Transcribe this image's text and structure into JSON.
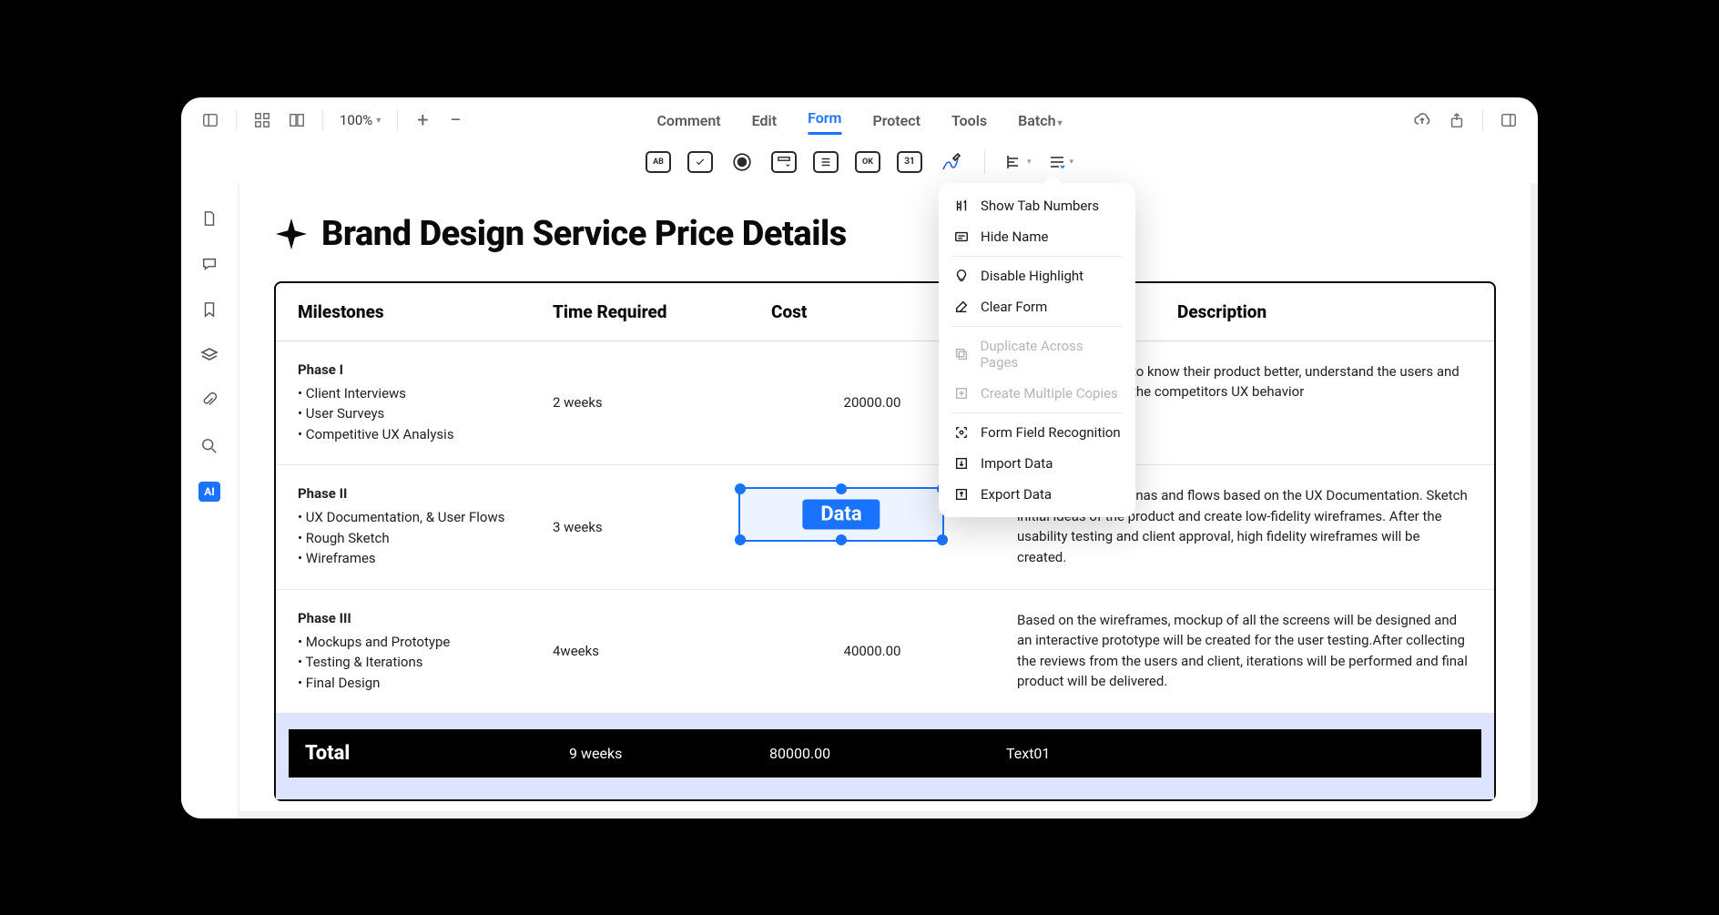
{
  "toolbar": {
    "zoom": "100%",
    "menus": [
      "Comment",
      "Edit",
      "Form",
      "Protect",
      "Tools",
      "Batch"
    ],
    "active_menu": "Form"
  },
  "form_tools": {
    "buttons": [
      "AB",
      "check",
      "radio",
      "dropdown",
      "list",
      "OK",
      "31",
      "sign"
    ],
    "align": "left",
    "more": "options"
  },
  "dropdown": {
    "items": [
      {
        "label": "Show Tab Numbers",
        "enabled": true,
        "icon": "numbers"
      },
      {
        "label": "Hide Name",
        "enabled": true,
        "icon": "name"
      },
      {
        "label": "Disable Highlight",
        "enabled": true,
        "icon": "highlight"
      },
      {
        "label": "Clear Form",
        "enabled": true,
        "icon": "erase"
      },
      {
        "label": "Duplicate Across Pages",
        "enabled": false,
        "icon": "duplicate"
      },
      {
        "label": "Create Multiple Copies",
        "enabled": false,
        "icon": "copies"
      },
      {
        "label": "Form Field Recognition",
        "enabled": true,
        "icon": "recognize"
      },
      {
        "label": "Import Data",
        "enabled": true,
        "icon": "import"
      },
      {
        "label": "Export Data",
        "enabled": true,
        "icon": "export"
      }
    ]
  },
  "document": {
    "title": "Brand Design Service Price Details",
    "columns": [
      "Milestones",
      "Time Required",
      "Cost",
      "Description"
    ],
    "rows": [
      {
        "phase": "Phase I",
        "bullets": [
          "Client Interviews",
          "User Surveys",
          "Competitive UX Analysis"
        ],
        "time": "2 weeks",
        "cost": "20000.00",
        "desc": "to know their product better, understand the users and the competitors UX behavior"
      },
      {
        "phase": "Phase II",
        "bullets": [
          "UX Documentation, & User Flows",
          "Rough Sketch",
          "Wireframes"
        ],
        "time": "3 weeks",
        "cost": "",
        "desc": "Creating user personas and flows based on the UX Documentation. Sketch initial ideas of the product and create low-fidelity wireframes. After the usability testing and client approval, high fidelity wireframes will be created."
      },
      {
        "phase": "Phase III",
        "bullets": [
          "Mockups and Prototype",
          "Testing & Iterations",
          "Final Design"
        ],
        "time": "4weeks",
        "cost": "40000.00",
        "desc": "Based on the wireframes, mockup of all the screens will be designed and an interactive prototype will be created for the user testing.After collecting the reviews from the users and client, iterations will be performed and final product will be delivered."
      }
    ],
    "total": {
      "label": "Total",
      "time": "9 weeks",
      "cost": "80000.00",
      "desc": "Text01"
    }
  },
  "selected_field": {
    "label": "Data"
  },
  "left_rail": {
    "ai_label": "AI"
  }
}
